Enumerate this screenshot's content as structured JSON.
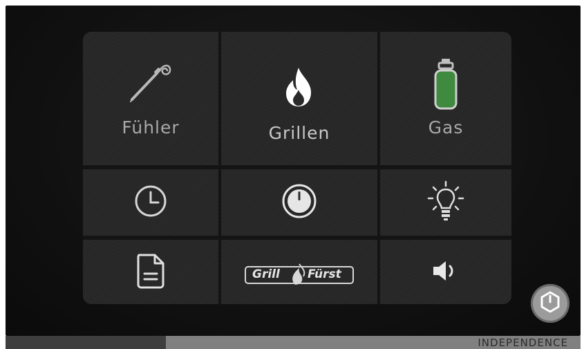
{
  "tiles": {
    "probe": {
      "label": "Fühler",
      "icon": "meat-probe-icon"
    },
    "grill": {
      "label": "Grillen",
      "icon": "flame-icon"
    },
    "gas": {
      "label": "Gas",
      "icon": "gas-bottle-icon",
      "level_color": "#3f8a3f"
    },
    "timer": {
      "icon": "clock-icon"
    },
    "knob": {
      "icon": "dial-knob-icon"
    },
    "light": {
      "icon": "light-bulb-icon"
    },
    "notes": {
      "icon": "document-icon"
    },
    "logo": {
      "icon": "grillfuerst-logo",
      "text_left": "Grill",
      "text_right": "Fürst"
    },
    "sound": {
      "icon": "speaker-icon"
    }
  },
  "power": {
    "icon": "power-icon"
  },
  "footer": {
    "brand": "INDEPENDENCE"
  },
  "colors": {
    "screen_bg": "#141414",
    "tile_bg": "#2a2a2a",
    "label": "#a9a9a9",
    "icon_active": "#ffffff",
    "gas_green": "#3f8a3f"
  }
}
